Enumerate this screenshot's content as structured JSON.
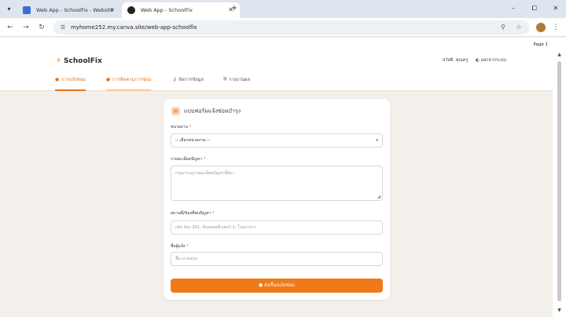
{
  "browser": {
    "tabs": [
      {
        "title": "Web App - SchoolFix - Website"
      },
      {
        "title": "Web App - SchoolFix"
      }
    ],
    "url": "myhome252.my.canva.site/web-app-schoolfix",
    "new_tab": "+",
    "window_buttons": {
      "minimize": "–",
      "maximize": "⧠",
      "close": "✕"
    }
  },
  "page": {
    "page_indicator": "Page 1",
    "logo": "SchoolFix",
    "user": "สวัสดี, คุณครู",
    "logout": "ออกจากระบบ",
    "nav": [
      {
        "label": "การแจ้งซ่อม"
      },
      {
        "label": "การติดตามการซ่อม"
      },
      {
        "label": "จัดการข้อมูล"
      },
      {
        "label": "รายงานผล"
      }
    ]
  },
  "form": {
    "title": "แบบฟอร์มแจ้งซ่อมบำรุง",
    "agency_label": "หน่วยงาน",
    "agency_value": "-- เลือกหน่วยงาน --",
    "problem_label": "รายละเอียดปัญหา",
    "problem_placeholder": "กรุณาระบุรายละเอียดปัญหาที่พบ...",
    "location_label": "สถานที่/ห้องที่พบปัญหา",
    "location_placeholder": "เช่น ห้อง 301, ห้องคอมพิวเตอร์ 2, โรงอาหาร",
    "reporter_label": "ชื่อผู้แจ้ง",
    "reporter_placeholder": "ชื่อ-นามสกุล",
    "required_mark": "*",
    "submit_label": "ส่งเรื่องแจ้งซ่อม"
  },
  "colors": {
    "accent": "#f07a1a",
    "page_bg": "#f3efea"
  }
}
